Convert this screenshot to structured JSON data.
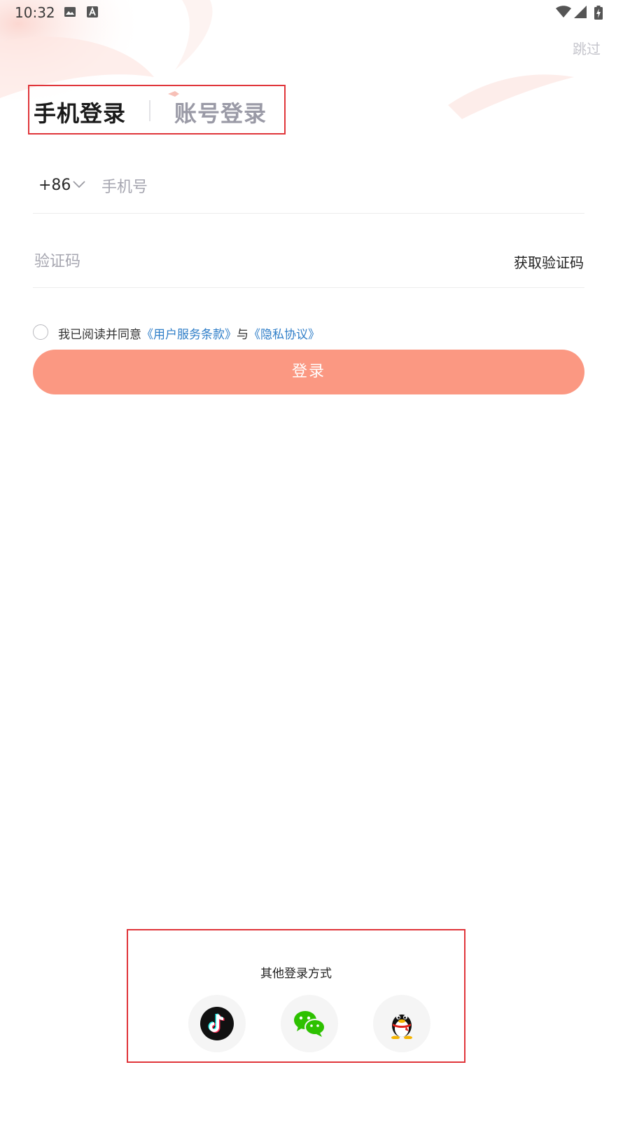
{
  "status_bar": {
    "time": "10:32",
    "icons": [
      "image-icon",
      "font-icon",
      "wifi-icon",
      "signal-icon",
      "battery-charging-icon"
    ]
  },
  "header": {
    "skip_label": "跳过"
  },
  "tabs": [
    {
      "label": "手机登录",
      "active": true
    },
    {
      "label": "账号登录",
      "active": false
    }
  ],
  "form": {
    "country_code": "+86",
    "phone_placeholder": "手机号",
    "code_placeholder": "验证码",
    "get_code_label": "获取验证码"
  },
  "agreement": {
    "prefix": "我已阅读并同意",
    "terms": "《用户服务条款》",
    "conjunction": "与",
    "privacy": "《隐私协议》"
  },
  "login_button": {
    "label": "登录",
    "color": "#fb9882"
  },
  "other_login": {
    "title": "其他登录方式",
    "providers": [
      "douyin-icon",
      "wechat-icon",
      "qq-icon"
    ]
  },
  "colors": {
    "accent": "#fb9882",
    "link": "#2f7ec8",
    "highlight_border": "#e0353a"
  }
}
